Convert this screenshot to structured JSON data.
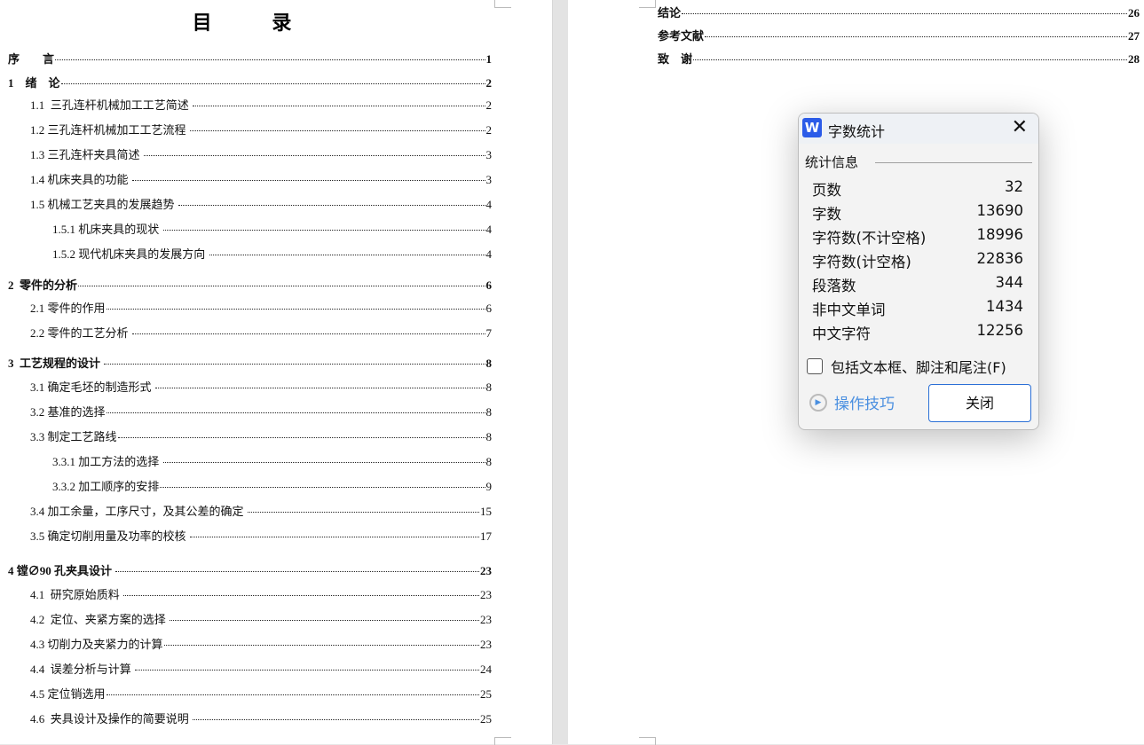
{
  "toc_title": "目 录",
  "left_entries": [
    {
      "label": "序　　言",
      "page": "1",
      "level": 0
    },
    {
      "label": "1　绪　论",
      "page": "2",
      "level": 0
    },
    {
      "label": "1.1  三孔连杆机械加工工艺简述 ",
      "page": "2",
      "level": 1
    },
    {
      "label": "1.2 三孔连杆机械加工工艺流程 ",
      "page": "2",
      "level": 1
    },
    {
      "label": "1.3 三孔连杆夹具简述 ",
      "page": "3",
      "level": 1
    },
    {
      "label": "1.4 机床夹具的功能 ",
      "page": "3",
      "level": 1
    },
    {
      "label": "1.5 机械工艺夹具的发展趋势 ",
      "page": "4",
      "level": 1
    },
    {
      "label": "1.5.1 机床夹具的现状 ",
      "page": "4",
      "level": 2
    },
    {
      "label": "1.5.2 现代机床夹具的发展方向 ",
      "page": "4",
      "level": 2
    },
    {
      "label": "2  零件的分析",
      "page": "6",
      "level": 0
    },
    {
      "label": "2.1 零件的作用",
      "page": "6",
      "level": 1
    },
    {
      "label": "2.2 零件的工艺分析 ",
      "page": "7",
      "level": 1
    },
    {
      "label": "3  工艺规程的设计 ",
      "page": "8",
      "level": 0
    },
    {
      "label": "3.1 确定毛坯的制造形式 ",
      "page": "8",
      "level": 1
    },
    {
      "label": "3.2 基准的选择",
      "page": "8",
      "level": 1
    },
    {
      "label": "3.3 制定工艺路线",
      "page": "8",
      "level": 1
    },
    {
      "label": "3.3.1 加工方法的选择 ",
      "page": "8",
      "level": 2
    },
    {
      "label": "3.3.2 加工顺序的安排",
      "page": "9",
      "level": 2
    },
    {
      "label": "3.4 加工余量，工序尺寸，及其公差的确定 ",
      "page": "15",
      "level": 1
    },
    {
      "label": "3.5 确定切削用量及功率的校核 ",
      "page": "17",
      "level": 1
    },
    {
      "label": "4 镗∅90 孔夹具设计 ",
      "page": "23",
      "level": 0
    },
    {
      "label": "4.1  研究原始质料 ",
      "page": "23",
      "level": 1
    },
    {
      "label": "4.2  定位、夹紧方案的选择 ",
      "page": "23",
      "level": 1
    },
    {
      "label": "4.3 切削力及夹紧力的计算",
      "page": "23",
      "level": 1
    },
    {
      "label": "4.4  误差分析与计算 ",
      "page": "24",
      "level": 1
    },
    {
      "label": "4.5 定位销选用",
      "page": "25",
      "level": 1
    },
    {
      "label": "4.6  夹具设计及操作的简要说明 ",
      "page": "25",
      "level": 1
    }
  ],
  "right_entries": [
    {
      "label": "结论",
      "page": "26",
      "level": 0
    },
    {
      "label": "参考文献",
      "page": "27",
      "level": 0
    },
    {
      "label": "致　谢",
      "page": "28",
      "level": 0
    }
  ],
  "dialog": {
    "title": "字数统计",
    "group": "统计信息",
    "stats": [
      {
        "label": "页数",
        "value": "32"
      },
      {
        "label": "字数",
        "value": "13690"
      },
      {
        "label": "字符数(不计空格)",
        "value": "18996"
      },
      {
        "label": "字符数(计空格)",
        "value": "22836"
      },
      {
        "label": "段落数",
        "value": "344"
      },
      {
        "label": "非中文单词",
        "value": "1434"
      },
      {
        "label": "中文字符",
        "value": "12256"
      }
    ],
    "checkbox_label": "包括文本框、脚注和尾注(F)",
    "checkbox_checked": false,
    "tips_label": "操作技巧",
    "close_label": "关闭",
    "accent": "#2b5be8"
  }
}
